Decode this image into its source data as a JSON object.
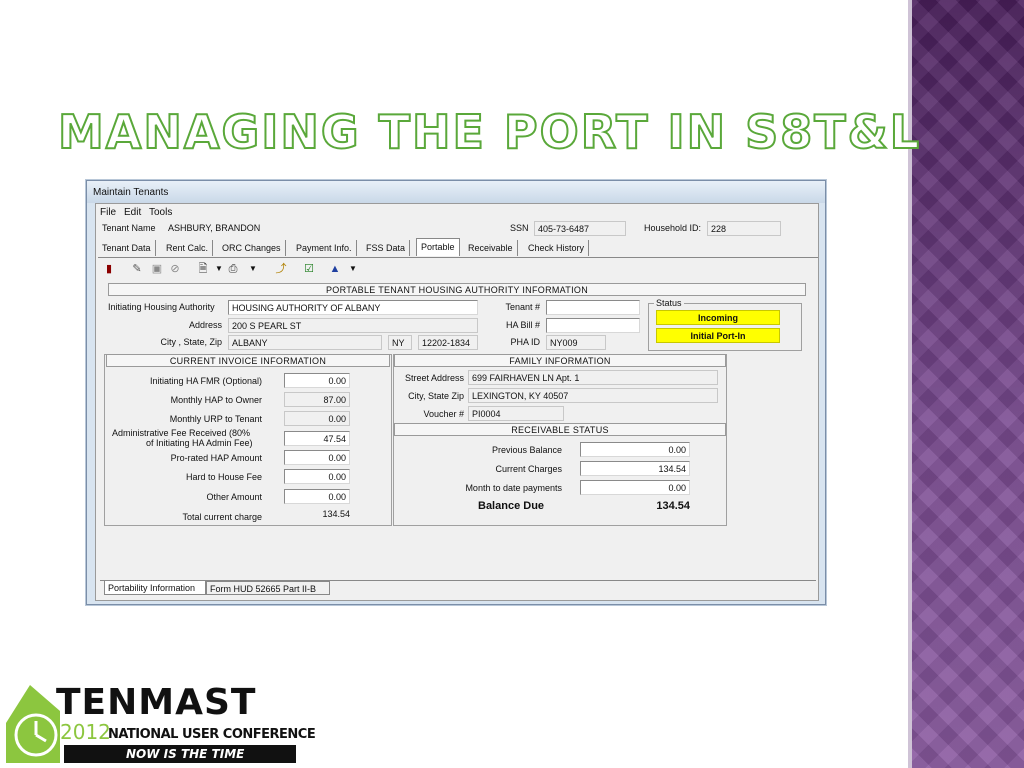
{
  "slide": {
    "title": "Managing the Port in S8T&L"
  },
  "window": {
    "title": "Maintain Tenants",
    "menu": [
      "File",
      "Edit",
      "Tools"
    ]
  },
  "tenant": {
    "name_label": "Tenant Name",
    "name": "ASHBURY, BRANDON",
    "ssn_label": "SSN",
    "ssn": "405-73-6487",
    "household_label": "Household ID:",
    "household_id": "228"
  },
  "tabs": [
    "Tenant Data",
    "Rent Calc.",
    "ORC Changes",
    "Payment Info.",
    "FSS Data",
    "Portable",
    "Receivable",
    "Check History"
  ],
  "active_tab": "Portable",
  "toolbar_icons": [
    "exit-icon",
    "edit-icon",
    "save-icon",
    "cancel-icon",
    "new-document-icon",
    "dropdown-arrow-icon",
    "print-icon",
    "dropdown-arrow-icon",
    "wand-icon",
    "checklist-icon",
    "flask-icon",
    "dropdown-arrow-icon"
  ],
  "portable": {
    "header": "PORTABLE TENANT HOUSING AUTHORITY INFORMATION",
    "initiating_label": "Initiating Housing Authority",
    "initiating_value": "HOUSING AUTHORITY OF ALBANY",
    "address_label": "Address",
    "address_value": "200 S PEARL ST",
    "csz_label": "City , State, Zip",
    "city": "ALBANY",
    "state": "NY",
    "zip": "12202-1834",
    "tenant_no_label": "Tenant #",
    "tenant_no": "",
    "ha_bill_label": "HA Bill #",
    "ha_bill": "",
    "pha_id_label": "PHA ID",
    "pha_id": "NY009",
    "status_label": "Status",
    "status_1": "Incoming",
    "status_2": "Initial Port-In"
  },
  "invoice": {
    "header": "CURRENT INVOICE INFORMATION",
    "rows": [
      {
        "label": "Initiating HA FMR (Optional)",
        "value": "0.00"
      },
      {
        "label": "Monthly HAP to Owner",
        "value": "87.00"
      },
      {
        "label": "Monthly URP to Tenant",
        "value": "0.00"
      },
      {
        "label": "Administrative Fee Received (80%",
        "label2": "of Initiating HA Admin Fee)",
        "value": "47.54"
      },
      {
        "label": "Pro-rated HAP Amount",
        "value": "0.00"
      },
      {
        "label": "Hard to House Fee",
        "value": "0.00"
      },
      {
        "label": "Other Amount",
        "value": "0.00"
      },
      {
        "label": "Total current charge",
        "value": "134.54"
      }
    ]
  },
  "family": {
    "header": "FAMILY INFORMATION",
    "street_label": "Street Address",
    "street": "699 FAIRHAVEN LN Apt. 1",
    "csz_label": "City, State  Zip",
    "csz": "LEXINGTON, KY 40507",
    "voucher_label": "Voucher #",
    "voucher": "PI0004"
  },
  "receivable": {
    "header": "RECEIVABLE STATUS",
    "prev_label": "Previous Balance",
    "prev": "0.00",
    "current_label": "Current Charges",
    "current": "134.54",
    "mtd_label": "Month to date payments",
    "mtd": "0.00",
    "balance_label": "Balance Due",
    "balance": "134.54"
  },
  "bottom_tabs": [
    "Portability Information",
    "Form HUD 52665 Part II-B"
  ],
  "logo": {
    "brand": "TENMAST",
    "year": "2012",
    "conference": "NATIONAL USER CONFERENCE",
    "tagline": "NOW IS THE TIME",
    "colors": {
      "green": "#8cc63f",
      "black": "#111111"
    }
  },
  "colors": {
    "title_outline": "#5aa83a",
    "purple": "#6c3d82",
    "status_yellow": "#ffff00"
  }
}
